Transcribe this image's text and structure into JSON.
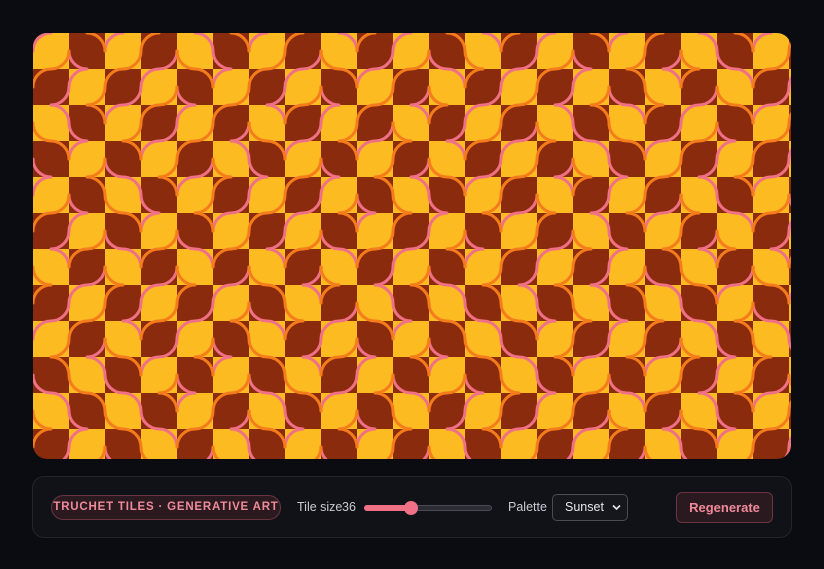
{
  "app": {
    "badge_label": "TRUCHET TILES · GENERATIVE ART"
  },
  "canvas": {
    "icon": "truchet-tile-pattern",
    "colors": {
      "tile_light": "#fdbb22",
      "tile_dark": "#8a2b0d",
      "arc_primary": "#f07086",
      "arc_secondary": "#f57c1b"
    }
  },
  "controls": {
    "tile_size_label": "Tile size",
    "tile_size_value": "36",
    "tile_size_slider": {
      "fraction": 0.37
    },
    "palette_label": "Palette",
    "palette_selected": "Sunset",
    "regenerate_label": "Regenerate",
    "accent_color": "#f07086"
  }
}
